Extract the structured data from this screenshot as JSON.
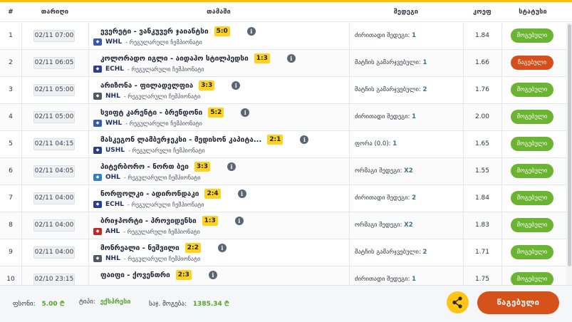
{
  "header": {
    "num": "#",
    "date": "თარიღი",
    "match": "თამაში",
    "outcome": "შედეგი",
    "odd": "კოეფ",
    "status": "სტატუსი"
  },
  "rows": [
    {
      "num": "1",
      "date": "02/11 07:00",
      "teams": "ევერეტი - ვანკუვერ ჯაიანტსი",
      "score": "5:0",
      "league": "WHL",
      "league_color": "#3a5aa8",
      "league_desc": "- რეგულარული ჩემპიონატი",
      "outcome_label": "ძირითადი შედეგი:",
      "outcome_value": "1",
      "odd": "1.84",
      "status": "მოგებული",
      "status_type": "win"
    },
    {
      "num": "2",
      "date": "02/11 06:05",
      "teams": "კოლორადო იგლი - აიდაჰო სტილჰედსი",
      "score": "1:3",
      "league": "ECHL",
      "league_color": "#2b3e8f",
      "league_desc": "- რეგულარული ჩემპიონატი",
      "outcome_label": "მატჩის გამარჯვებული:",
      "outcome_value": "1",
      "odd": "1.66",
      "status": "წაგებული",
      "status_type": "lose"
    },
    {
      "num": "3",
      "date": "02/11 05:00",
      "teams": "არიზონა - ფილადელფია",
      "score": "3:3",
      "league": "NHL",
      "league_color": "#555a60",
      "league_desc": "- რეგულარული ჩემპიონატი",
      "outcome_label": "მატჩის გამარჯვებული:",
      "outcome_value": "2",
      "odd": "1.76",
      "status": "მოგებული",
      "status_type": "win"
    },
    {
      "num": "4",
      "date": "02/11 05:00",
      "teams": "სვიფტ კარენტი - ბრენდონი",
      "score": "5:2",
      "league": "WHL",
      "league_color": "#3a5aa8",
      "league_desc": "- რეგულარული ჩემპიონატი",
      "outcome_label": "ძირითადი შედეგი:",
      "outcome_value": "1",
      "odd": "2.00",
      "status": "მოგებული",
      "status_type": "win"
    },
    {
      "num": "5",
      "date": "02/11 04:15",
      "teams": "მასკეგონ ლამბერჯეკსი - მედისონ კაპიტა...",
      "score": "2:1",
      "league": "USHL",
      "league_color": "#2c3f86",
      "league_desc": "- რეგულარული ჩემპიონატი",
      "outcome_label": "ფორა (0.0):",
      "outcome_value": "1",
      "odd": "1.65",
      "status": "მოგებული",
      "status_type": "win"
    },
    {
      "num": "6",
      "date": "02/11 04:05",
      "teams": "პიტერბორო - ნორთ ბეი",
      "score": "3:3",
      "league": "OHL",
      "league_color": "#2f80c5",
      "league_desc": "- რეგულარული ჩემპიონატი",
      "outcome_label": "ორმაგი შედეგი:",
      "outcome_value": "X2",
      "odd": "1.55",
      "status": "მოგებული",
      "status_type": "win"
    },
    {
      "num": "7",
      "date": "02/11 04:00",
      "teams": "ნორფოლკი - ადირონდაკი",
      "score": "2:4",
      "league": "ECHL",
      "league_color": "#2b3e8f",
      "league_desc": "- რეგულარული ჩემპიონატი",
      "outcome_label": "ძირითადი შედეგი:",
      "outcome_value": "2",
      "odd": "1.84",
      "status": "მოგებული",
      "status_type": "win"
    },
    {
      "num": "8",
      "date": "02/11 04:00",
      "teams": "ბრიჯპორტი - პროვიდენსი",
      "score": "1:3",
      "league": "AHL",
      "league_color": "#c02a2a",
      "league_desc": "- რეგულარული ჩემპიონატი",
      "outcome_label": "ორმაგი შედეგი:",
      "outcome_value": "X2",
      "odd": "1.83",
      "status": "მოგებული",
      "status_type": "win"
    },
    {
      "num": "9",
      "date": "02/11 04:00",
      "teams": "მონრეალი - ნეშვილი",
      "score": "2:2",
      "league": "NHL",
      "league_color": "#555a60",
      "league_desc": "- რეგულარული ჩემპიონატი",
      "outcome_label": "მატჩის გამარჯვებული:",
      "outcome_value": "2",
      "odd": "1.71",
      "status": "მოგებული",
      "status_type": "win"
    },
    {
      "num": "10",
      "date": "02/10 23:15",
      "teams": "ფაიფი - ქოვენთრი",
      "score": "2:3",
      "league": "",
      "league_color": "#3a5aa8",
      "league_desc": "",
      "outcome_label": "ძირითადი შედეგი:",
      "outcome_value": "1",
      "odd": "1.75",
      "status": "მოგებული",
      "status_type": "win"
    }
  ],
  "footer": {
    "stake_label": "ფსონი:",
    "stake_value": "5.00 ₾",
    "type_label": "ტიპი:",
    "type_value": "ექსპრესი",
    "total_label": "საჯ. მოგება:",
    "total_value": "1385.34 ₾",
    "close_label": "წაგებული"
  },
  "colors": {
    "accent": "#f8c200",
    "win": "#6ab431",
    "lose": "#d54f1a",
    "score_bg": "#ffd21f",
    "share": "#ffc414"
  }
}
